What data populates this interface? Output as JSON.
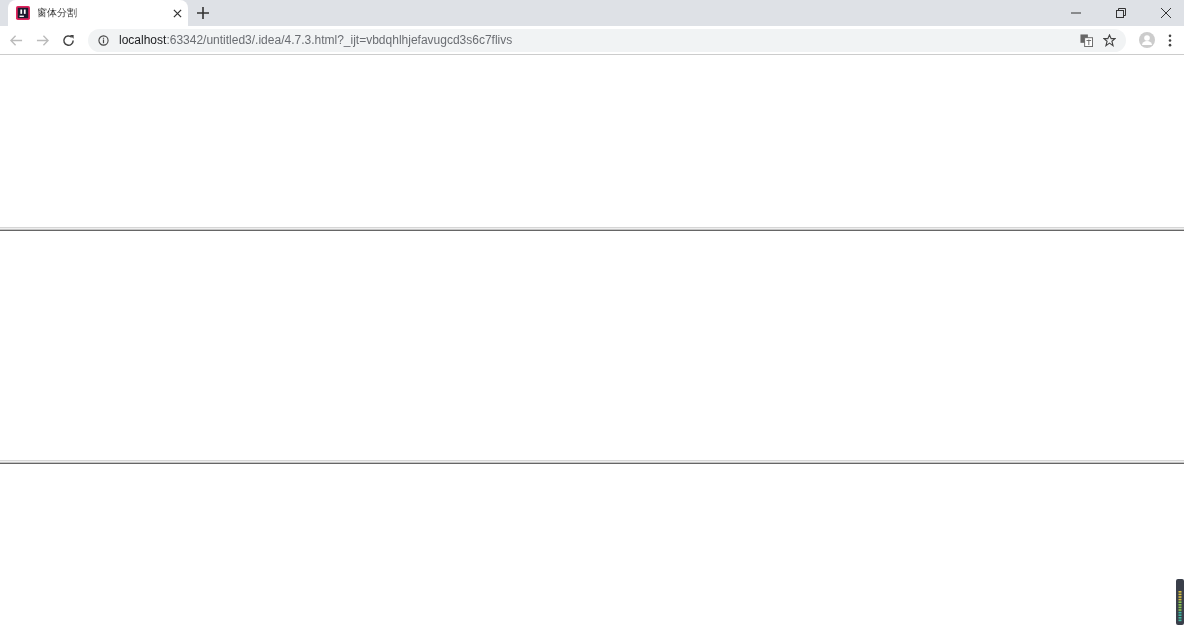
{
  "tabs": [
    {
      "title": "窗体分割",
      "selected": true
    }
  ],
  "address_bar": {
    "host": "localhost",
    "path": ":63342/untitled3/.idea/4.7.3.html?_ijt=vbdqhlhjefavugcd3s6c7flivs"
  }
}
